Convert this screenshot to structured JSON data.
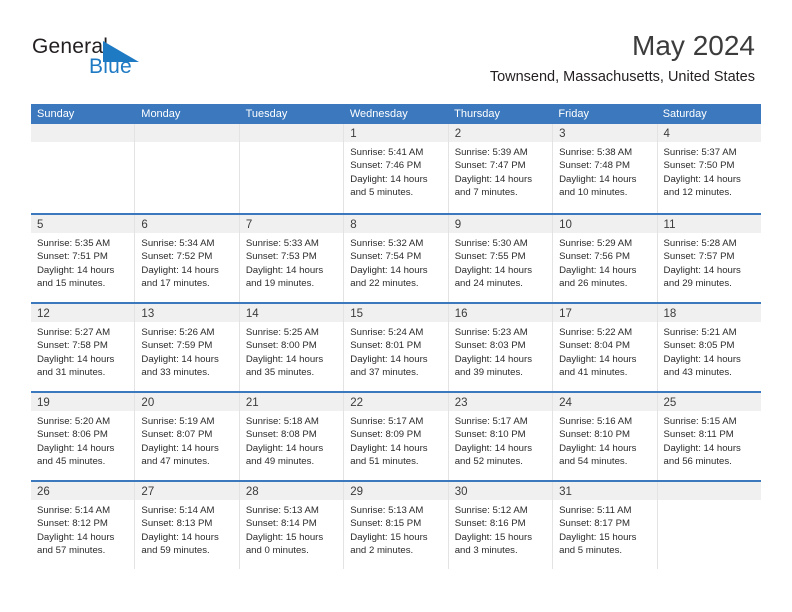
{
  "brand": {
    "name_part1": "General",
    "name_part2": "Blue",
    "logo_icon": "blue-triangle-mark",
    "accent_color": "#1f7ac4"
  },
  "header": {
    "month_title": "May 2024",
    "location": "Townsend, Massachusetts, United States"
  },
  "calendar": {
    "header_color": "#3b78bd",
    "day_band_color": "#f0f0f0",
    "weekdays": [
      "Sunday",
      "Monday",
      "Tuesday",
      "Wednesday",
      "Thursday",
      "Friday",
      "Saturday"
    ],
    "weeks": [
      [
        {
          "day": "",
          "empty": true
        },
        {
          "day": "",
          "empty": true
        },
        {
          "day": "",
          "empty": true
        },
        {
          "day": "1",
          "sunrise": "Sunrise: 5:41 AM",
          "sunset": "Sunset: 7:46 PM",
          "daylight_line1": "Daylight: 14 hours",
          "daylight_line2": "and 5 minutes."
        },
        {
          "day": "2",
          "sunrise": "Sunrise: 5:39 AM",
          "sunset": "Sunset: 7:47 PM",
          "daylight_line1": "Daylight: 14 hours",
          "daylight_line2": "and 7 minutes."
        },
        {
          "day": "3",
          "sunrise": "Sunrise: 5:38 AM",
          "sunset": "Sunset: 7:48 PM",
          "daylight_line1": "Daylight: 14 hours",
          "daylight_line2": "and 10 minutes."
        },
        {
          "day": "4",
          "sunrise": "Sunrise: 5:37 AM",
          "sunset": "Sunset: 7:50 PM",
          "daylight_line1": "Daylight: 14 hours",
          "daylight_line2": "and 12 minutes."
        }
      ],
      [
        {
          "day": "5",
          "sunrise": "Sunrise: 5:35 AM",
          "sunset": "Sunset: 7:51 PM",
          "daylight_line1": "Daylight: 14 hours",
          "daylight_line2": "and 15 minutes."
        },
        {
          "day": "6",
          "sunrise": "Sunrise: 5:34 AM",
          "sunset": "Sunset: 7:52 PM",
          "daylight_line1": "Daylight: 14 hours",
          "daylight_line2": "and 17 minutes."
        },
        {
          "day": "7",
          "sunrise": "Sunrise: 5:33 AM",
          "sunset": "Sunset: 7:53 PM",
          "daylight_line1": "Daylight: 14 hours",
          "daylight_line2": "and 19 minutes."
        },
        {
          "day": "8",
          "sunrise": "Sunrise: 5:32 AM",
          "sunset": "Sunset: 7:54 PM",
          "daylight_line1": "Daylight: 14 hours",
          "daylight_line2": "and 22 minutes."
        },
        {
          "day": "9",
          "sunrise": "Sunrise: 5:30 AM",
          "sunset": "Sunset: 7:55 PM",
          "daylight_line1": "Daylight: 14 hours",
          "daylight_line2": "and 24 minutes."
        },
        {
          "day": "10",
          "sunrise": "Sunrise: 5:29 AM",
          "sunset": "Sunset: 7:56 PM",
          "daylight_line1": "Daylight: 14 hours",
          "daylight_line2": "and 26 minutes."
        },
        {
          "day": "11",
          "sunrise": "Sunrise: 5:28 AM",
          "sunset": "Sunset: 7:57 PM",
          "daylight_line1": "Daylight: 14 hours",
          "daylight_line2": "and 29 minutes."
        }
      ],
      [
        {
          "day": "12",
          "sunrise": "Sunrise: 5:27 AM",
          "sunset": "Sunset: 7:58 PM",
          "daylight_line1": "Daylight: 14 hours",
          "daylight_line2": "and 31 minutes."
        },
        {
          "day": "13",
          "sunrise": "Sunrise: 5:26 AM",
          "sunset": "Sunset: 7:59 PM",
          "daylight_line1": "Daylight: 14 hours",
          "daylight_line2": "and 33 minutes."
        },
        {
          "day": "14",
          "sunrise": "Sunrise: 5:25 AM",
          "sunset": "Sunset: 8:00 PM",
          "daylight_line1": "Daylight: 14 hours",
          "daylight_line2": "and 35 minutes."
        },
        {
          "day": "15",
          "sunrise": "Sunrise: 5:24 AM",
          "sunset": "Sunset: 8:01 PM",
          "daylight_line1": "Daylight: 14 hours",
          "daylight_line2": "and 37 minutes."
        },
        {
          "day": "16",
          "sunrise": "Sunrise: 5:23 AM",
          "sunset": "Sunset: 8:03 PM",
          "daylight_line1": "Daylight: 14 hours",
          "daylight_line2": "and 39 minutes."
        },
        {
          "day": "17",
          "sunrise": "Sunrise: 5:22 AM",
          "sunset": "Sunset: 8:04 PM",
          "daylight_line1": "Daylight: 14 hours",
          "daylight_line2": "and 41 minutes."
        },
        {
          "day": "18",
          "sunrise": "Sunrise: 5:21 AM",
          "sunset": "Sunset: 8:05 PM",
          "daylight_line1": "Daylight: 14 hours",
          "daylight_line2": "and 43 minutes."
        }
      ],
      [
        {
          "day": "19",
          "sunrise": "Sunrise: 5:20 AM",
          "sunset": "Sunset: 8:06 PM",
          "daylight_line1": "Daylight: 14 hours",
          "daylight_line2": "and 45 minutes."
        },
        {
          "day": "20",
          "sunrise": "Sunrise: 5:19 AM",
          "sunset": "Sunset: 8:07 PM",
          "daylight_line1": "Daylight: 14 hours",
          "daylight_line2": "and 47 minutes."
        },
        {
          "day": "21",
          "sunrise": "Sunrise: 5:18 AM",
          "sunset": "Sunset: 8:08 PM",
          "daylight_line1": "Daylight: 14 hours",
          "daylight_line2": "and 49 minutes."
        },
        {
          "day": "22",
          "sunrise": "Sunrise: 5:17 AM",
          "sunset": "Sunset: 8:09 PM",
          "daylight_line1": "Daylight: 14 hours",
          "daylight_line2": "and 51 minutes."
        },
        {
          "day": "23",
          "sunrise": "Sunrise: 5:17 AM",
          "sunset": "Sunset: 8:10 PM",
          "daylight_line1": "Daylight: 14 hours",
          "daylight_line2": "and 52 minutes."
        },
        {
          "day": "24",
          "sunrise": "Sunrise: 5:16 AM",
          "sunset": "Sunset: 8:10 PM",
          "daylight_line1": "Daylight: 14 hours",
          "daylight_line2": "and 54 minutes."
        },
        {
          "day": "25",
          "sunrise": "Sunrise: 5:15 AM",
          "sunset": "Sunset: 8:11 PM",
          "daylight_line1": "Daylight: 14 hours",
          "daylight_line2": "and 56 minutes."
        }
      ],
      [
        {
          "day": "26",
          "sunrise": "Sunrise: 5:14 AM",
          "sunset": "Sunset: 8:12 PM",
          "daylight_line1": "Daylight: 14 hours",
          "daylight_line2": "and 57 minutes."
        },
        {
          "day": "27",
          "sunrise": "Sunrise: 5:14 AM",
          "sunset": "Sunset: 8:13 PM",
          "daylight_line1": "Daylight: 14 hours",
          "daylight_line2": "and 59 minutes."
        },
        {
          "day": "28",
          "sunrise": "Sunrise: 5:13 AM",
          "sunset": "Sunset: 8:14 PM",
          "daylight_line1": "Daylight: 15 hours",
          "daylight_line2": "and 0 minutes."
        },
        {
          "day": "29",
          "sunrise": "Sunrise: 5:13 AM",
          "sunset": "Sunset: 8:15 PM",
          "daylight_line1": "Daylight: 15 hours",
          "daylight_line2": "and 2 minutes."
        },
        {
          "day": "30",
          "sunrise": "Sunrise: 5:12 AM",
          "sunset": "Sunset: 8:16 PM",
          "daylight_line1": "Daylight: 15 hours",
          "daylight_line2": "and 3 minutes."
        },
        {
          "day": "31",
          "sunrise": "Sunrise: 5:11 AM",
          "sunset": "Sunset: 8:17 PM",
          "daylight_line1": "Daylight: 15 hours",
          "daylight_line2": "and 5 minutes."
        },
        {
          "day": "",
          "empty": true
        }
      ]
    ]
  }
}
